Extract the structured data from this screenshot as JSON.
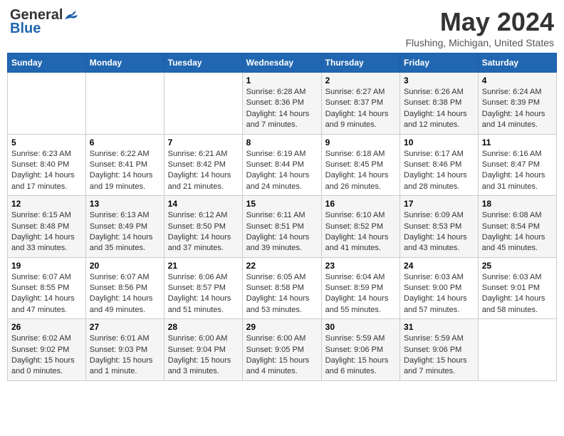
{
  "header": {
    "logo_general": "General",
    "logo_blue": "Blue",
    "month": "May 2024",
    "location": "Flushing, Michigan, United States"
  },
  "weekdays": [
    "Sunday",
    "Monday",
    "Tuesday",
    "Wednesday",
    "Thursday",
    "Friday",
    "Saturday"
  ],
  "weeks": [
    [
      {
        "day": "",
        "info": ""
      },
      {
        "day": "",
        "info": ""
      },
      {
        "day": "",
        "info": ""
      },
      {
        "day": "1",
        "info": "Sunrise: 6:28 AM\nSunset: 8:36 PM\nDaylight: 14 hours\nand 7 minutes."
      },
      {
        "day": "2",
        "info": "Sunrise: 6:27 AM\nSunset: 8:37 PM\nDaylight: 14 hours\nand 9 minutes."
      },
      {
        "day": "3",
        "info": "Sunrise: 6:26 AM\nSunset: 8:38 PM\nDaylight: 14 hours\nand 12 minutes."
      },
      {
        "day": "4",
        "info": "Sunrise: 6:24 AM\nSunset: 8:39 PM\nDaylight: 14 hours\nand 14 minutes."
      }
    ],
    [
      {
        "day": "5",
        "info": "Sunrise: 6:23 AM\nSunset: 8:40 PM\nDaylight: 14 hours\nand 17 minutes."
      },
      {
        "day": "6",
        "info": "Sunrise: 6:22 AM\nSunset: 8:41 PM\nDaylight: 14 hours\nand 19 minutes."
      },
      {
        "day": "7",
        "info": "Sunrise: 6:21 AM\nSunset: 8:42 PM\nDaylight: 14 hours\nand 21 minutes."
      },
      {
        "day": "8",
        "info": "Sunrise: 6:19 AM\nSunset: 8:44 PM\nDaylight: 14 hours\nand 24 minutes."
      },
      {
        "day": "9",
        "info": "Sunrise: 6:18 AM\nSunset: 8:45 PM\nDaylight: 14 hours\nand 26 minutes."
      },
      {
        "day": "10",
        "info": "Sunrise: 6:17 AM\nSunset: 8:46 PM\nDaylight: 14 hours\nand 28 minutes."
      },
      {
        "day": "11",
        "info": "Sunrise: 6:16 AM\nSunset: 8:47 PM\nDaylight: 14 hours\nand 31 minutes."
      }
    ],
    [
      {
        "day": "12",
        "info": "Sunrise: 6:15 AM\nSunset: 8:48 PM\nDaylight: 14 hours\nand 33 minutes."
      },
      {
        "day": "13",
        "info": "Sunrise: 6:13 AM\nSunset: 8:49 PM\nDaylight: 14 hours\nand 35 minutes."
      },
      {
        "day": "14",
        "info": "Sunrise: 6:12 AM\nSunset: 8:50 PM\nDaylight: 14 hours\nand 37 minutes."
      },
      {
        "day": "15",
        "info": "Sunrise: 6:11 AM\nSunset: 8:51 PM\nDaylight: 14 hours\nand 39 minutes."
      },
      {
        "day": "16",
        "info": "Sunrise: 6:10 AM\nSunset: 8:52 PM\nDaylight: 14 hours\nand 41 minutes."
      },
      {
        "day": "17",
        "info": "Sunrise: 6:09 AM\nSunset: 8:53 PM\nDaylight: 14 hours\nand 43 minutes."
      },
      {
        "day": "18",
        "info": "Sunrise: 6:08 AM\nSunset: 8:54 PM\nDaylight: 14 hours\nand 45 minutes."
      }
    ],
    [
      {
        "day": "19",
        "info": "Sunrise: 6:07 AM\nSunset: 8:55 PM\nDaylight: 14 hours\nand 47 minutes."
      },
      {
        "day": "20",
        "info": "Sunrise: 6:07 AM\nSunset: 8:56 PM\nDaylight: 14 hours\nand 49 minutes."
      },
      {
        "day": "21",
        "info": "Sunrise: 6:06 AM\nSunset: 8:57 PM\nDaylight: 14 hours\nand 51 minutes."
      },
      {
        "day": "22",
        "info": "Sunrise: 6:05 AM\nSunset: 8:58 PM\nDaylight: 14 hours\nand 53 minutes."
      },
      {
        "day": "23",
        "info": "Sunrise: 6:04 AM\nSunset: 8:59 PM\nDaylight: 14 hours\nand 55 minutes."
      },
      {
        "day": "24",
        "info": "Sunrise: 6:03 AM\nSunset: 9:00 PM\nDaylight: 14 hours\nand 57 minutes."
      },
      {
        "day": "25",
        "info": "Sunrise: 6:03 AM\nSunset: 9:01 PM\nDaylight: 14 hours\nand 58 minutes."
      }
    ],
    [
      {
        "day": "26",
        "info": "Sunrise: 6:02 AM\nSunset: 9:02 PM\nDaylight: 15 hours\nand 0 minutes."
      },
      {
        "day": "27",
        "info": "Sunrise: 6:01 AM\nSunset: 9:03 PM\nDaylight: 15 hours\nand 1 minute."
      },
      {
        "day": "28",
        "info": "Sunrise: 6:00 AM\nSunset: 9:04 PM\nDaylight: 15 hours\nand 3 minutes."
      },
      {
        "day": "29",
        "info": "Sunrise: 6:00 AM\nSunset: 9:05 PM\nDaylight: 15 hours\nand 4 minutes."
      },
      {
        "day": "30",
        "info": "Sunrise: 5:59 AM\nSunset: 9:06 PM\nDaylight: 15 hours\nand 6 minutes."
      },
      {
        "day": "31",
        "info": "Sunrise: 5:59 AM\nSunset: 9:06 PM\nDaylight: 15 hours\nand 7 minutes."
      },
      {
        "day": "",
        "info": ""
      }
    ]
  ]
}
